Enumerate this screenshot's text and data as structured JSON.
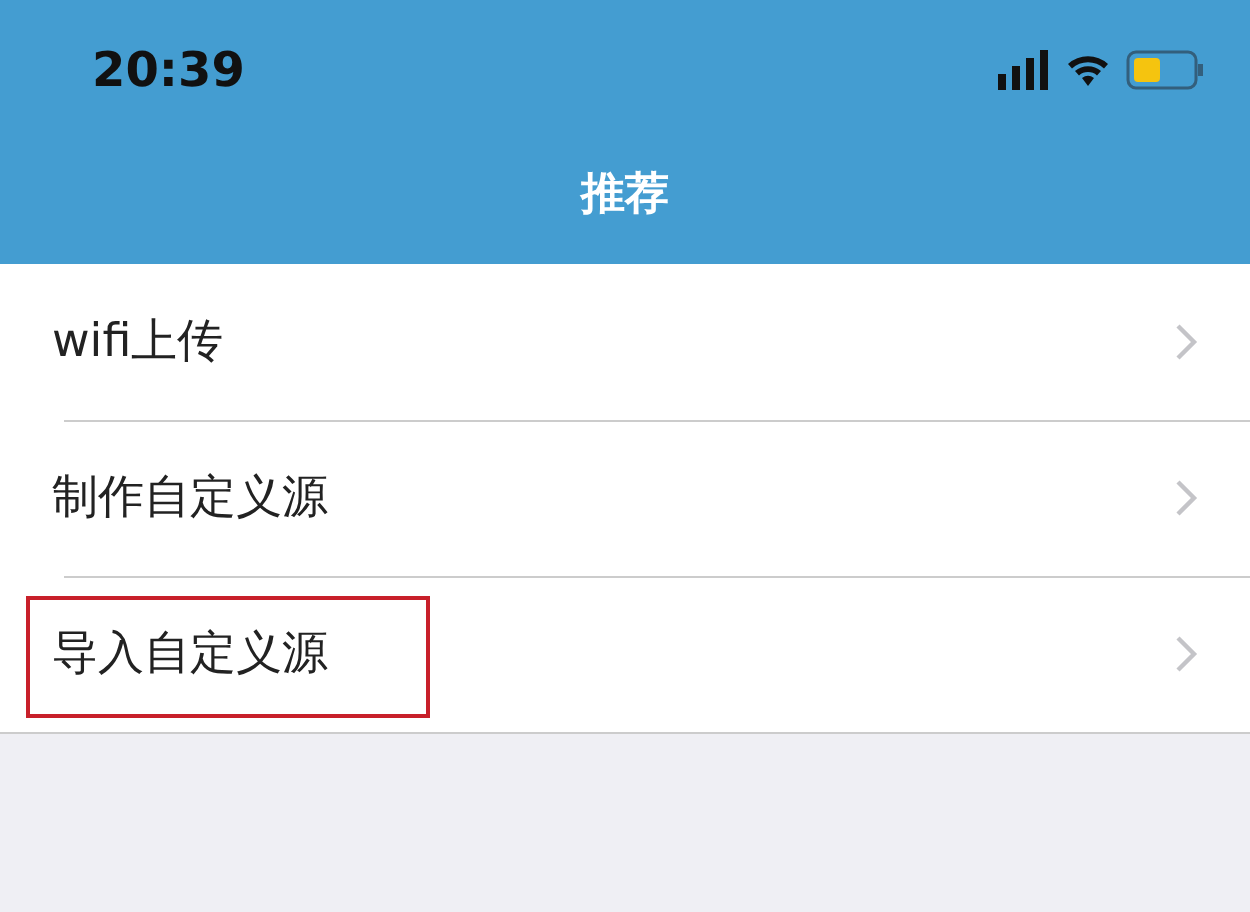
{
  "status_bar": {
    "time": "20:39"
  },
  "nav_bar": {
    "title": "推荐"
  },
  "items": [
    {
      "label": "wifi上传",
      "highlighted": false
    },
    {
      "label": "制作自定义源",
      "highlighted": false
    },
    {
      "label": "导入自定义源",
      "highlighted": true
    }
  ]
}
